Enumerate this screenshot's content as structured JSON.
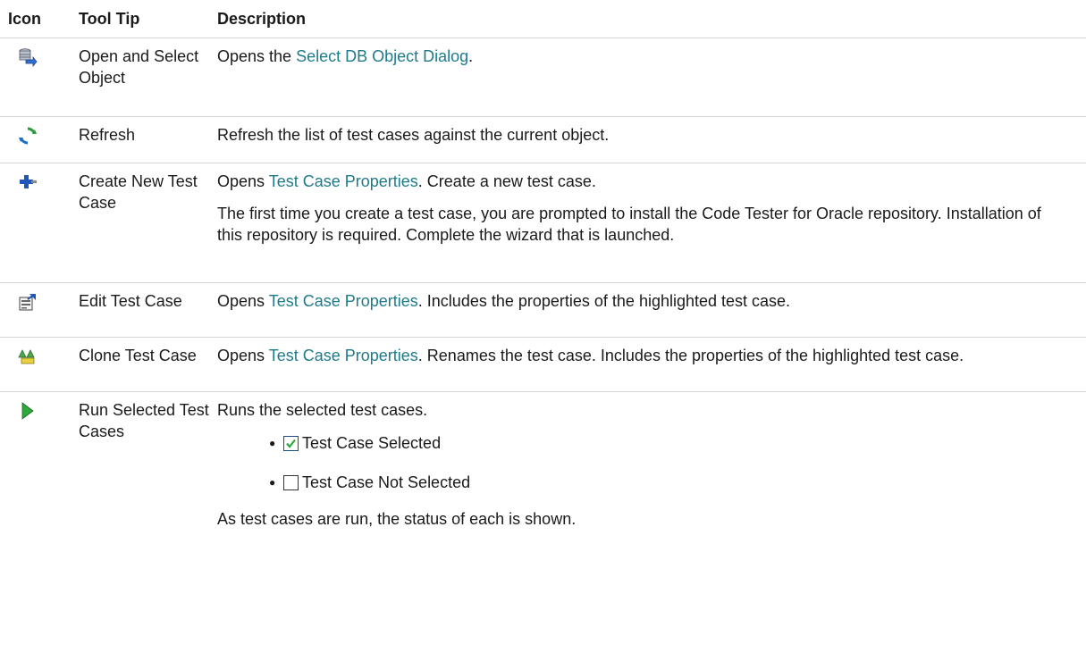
{
  "headers": {
    "icon": "Icon",
    "tooltip": "Tool Tip",
    "description": "Description"
  },
  "rows": [
    {
      "icon": "open-select-db-icon",
      "tooltip": "Open and Select Object",
      "desc_pre": "Opens the ",
      "desc_link": "Select DB Object Dialog",
      "desc_post": "."
    },
    {
      "icon": "refresh-icon",
      "tooltip": "Refresh",
      "desc": "Refresh the list of test cases against the current object."
    },
    {
      "icon": "create-new-test-case-icon",
      "tooltip": "Create New Test Case",
      "desc_pre": "Opens ",
      "desc_link": "Test Case Properties",
      "desc_post": ". Create a new test case.",
      "desc_extra": "The first time you create a test case, you are prompted to install the Code Tester for Oracle repository. Installation of this repository is required. Complete the wizard that is launched."
    },
    {
      "icon": "edit-test-case-icon",
      "tooltip": "Edit Test Case",
      "desc_pre": "Opens ",
      "desc_link": "Test Case Properties",
      "desc_post": ". Includes the properties of the highlighted test case."
    },
    {
      "icon": "clone-test-case-icon",
      "tooltip": "Clone Test Case",
      "desc_pre": "Opens ",
      "desc_link": "Test Case Properties",
      "desc_post": ". Renames the test case. Includes the properties of the highlighted test case."
    },
    {
      "icon": "run-selected-icon",
      "tooltip": "Run Selected Test Cases",
      "desc": "Runs the selected test cases.",
      "bullets": [
        "Test Case Selected",
        "Test Case Not Selected"
      ],
      "desc_after": "As test cases are run, the status of each is shown."
    }
  ],
  "colors": {
    "link": "#1e7b8a",
    "rule": "#d4d4d4"
  }
}
